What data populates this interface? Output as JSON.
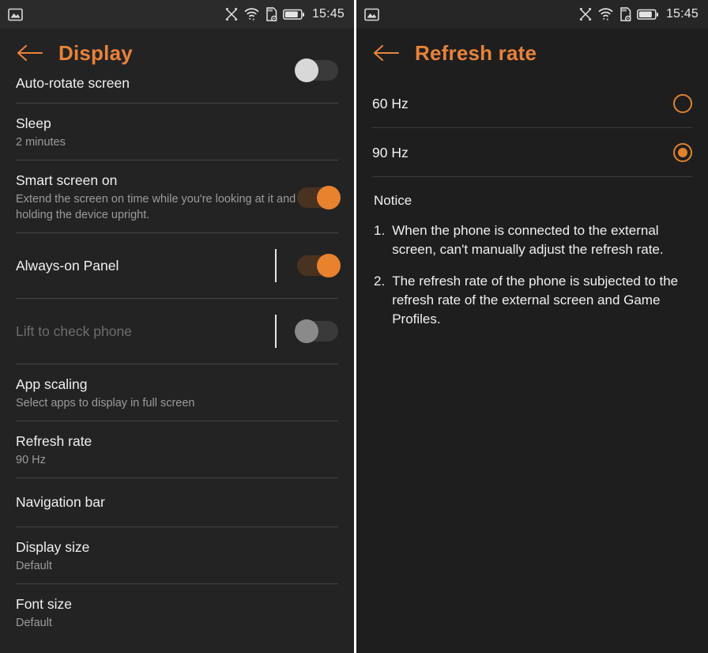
{
  "status_bar": {
    "left_icons": [
      "photo-icon"
    ],
    "right_icons": [
      "x-app-icon",
      "wifi-icon",
      "sd-card-icon",
      "battery-icon"
    ],
    "time": "15:45"
  },
  "left_panel": {
    "title": "Display",
    "back_icon": "back-arrow-icon",
    "rows": [
      {
        "title": "Auto-rotate screen",
        "sub": "",
        "control": "toggle-off-clipped"
      },
      {
        "title": "Sleep",
        "sub": "2 minutes",
        "control": "none"
      },
      {
        "title": "Smart screen on",
        "sub": "Extend the screen on time while you're looking at it and holding the device upright.",
        "control": "toggle-on"
      },
      {
        "title": "Always-on Panel",
        "sub": "",
        "control": "toggle-on-sep"
      },
      {
        "title": "Lift to check phone",
        "sub": "",
        "control": "toggle-off-sep",
        "disabled": true
      },
      {
        "title": "App scaling",
        "sub": "Select apps to display in full screen",
        "control": "none"
      },
      {
        "title": "Refresh rate",
        "sub": "90 Hz",
        "control": "none"
      },
      {
        "title": "Navigation bar",
        "sub": "",
        "control": "none"
      },
      {
        "title": "Display size",
        "sub": "Default",
        "control": "none"
      },
      {
        "title": "Font size",
        "sub": "Default",
        "control": "none"
      }
    ]
  },
  "right_panel": {
    "title": "Refresh rate",
    "back_icon": "back-arrow-icon",
    "options": [
      {
        "label": "60 Hz",
        "selected": false
      },
      {
        "label": "90 Hz",
        "selected": true
      }
    ],
    "notice": {
      "title": "Notice",
      "items": [
        {
          "num": "1.",
          "text": "When the phone is connected to the external screen, can't manually adjust the refresh rate."
        },
        {
          "num": "2.",
          "text": "The refresh rate of the phone is subjected to the refresh rate of the external screen and Game Profiles."
        }
      ]
    }
  },
  "colors": {
    "accent": "#e8823a",
    "background": "#232323",
    "background_right": "#1e1e1e",
    "divider": "#454545",
    "toggle_on_thumb": "#e8822e",
    "toggle_off_thumb": "#8a8a8a",
    "text_primary": "#f0f0f0",
    "text_secondary": "#9b9b9b",
    "text_disabled": "#6d6d6d"
  }
}
